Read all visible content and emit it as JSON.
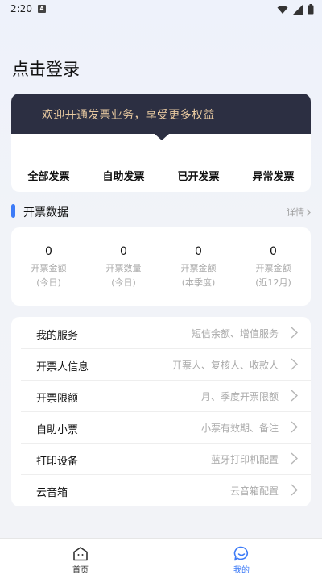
{
  "status": {
    "time": "2:20",
    "notification_letter": "A"
  },
  "login": {
    "title": "点击登录"
  },
  "promo": {
    "text": "欢迎开通发票业务，享受更多权益"
  },
  "invoice_tabs": [
    "全部发票",
    "自助发票",
    "已开发票",
    "异常发票"
  ],
  "section": {
    "title": "开票数据",
    "detail_label": "详情"
  },
  "stats": [
    {
      "value": "0",
      "label": "开票金额",
      "period": "(今日)"
    },
    {
      "value": "0",
      "label": "开票数量",
      "period": "(今日)"
    },
    {
      "value": "0",
      "label": "开票金额",
      "period": "(本季度)"
    },
    {
      "value": "0",
      "label": "开票金额",
      "period": "(近12月)"
    }
  ],
  "menu": [
    {
      "label": "我的服务",
      "desc": "短信余额、增值服务"
    },
    {
      "label": "开票人信息",
      "desc": "开票人、复核人、收款人"
    },
    {
      "label": "开票限额",
      "desc": "月、季度开票限额"
    },
    {
      "label": "自助小票",
      "desc": "小票有效期、备注"
    },
    {
      "label": "打印设备",
      "desc": "蓝牙打印机配置"
    },
    {
      "label": "云音箱",
      "desc": "云音箱配置"
    }
  ],
  "tabbar": {
    "home_label": "首页",
    "mine_label": "我的"
  },
  "colors": {
    "accent": "#3d7bf7",
    "banner": "#2c2f42",
    "banner_text": "#e8c9a0"
  }
}
